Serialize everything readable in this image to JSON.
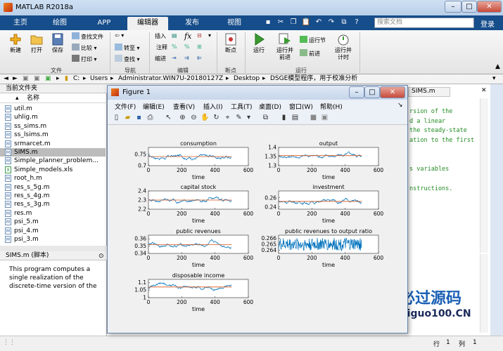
{
  "app": {
    "title": "MATLAB R2018a"
  },
  "tabs": [
    "主页",
    "绘图",
    "APP",
    "编辑器",
    "发布",
    "视图"
  ],
  "search": {
    "placeholder": "搜索文档"
  },
  "login": "登录",
  "ribbon": {
    "file": {
      "new": "新建",
      "open": "打开",
      "save": "保存",
      "find_files": "查找文件",
      "compare": "比较",
      "print": "打印",
      "label": "文件"
    },
    "nav": {
      "goto": "转至",
      "find": "查找",
      "label": "导航"
    },
    "edit": {
      "insert": "插入",
      "comment": "注释",
      "indent": "缩进",
      "label": "编辑",
      "fx": "fx"
    },
    "breakpoints": {
      "label": "断点",
      "btn": "断点"
    },
    "run": {
      "run": "运行",
      "run_advance": "运行并\n前进",
      "run_section": "运行节",
      "advance": "前进",
      "run_time": "运行并\n计时",
      "label": "运行"
    }
  },
  "address": {
    "path": [
      "C:",
      "Users",
      "Administrator.WIN7U-20180127Z",
      "Desktop",
      "DSGE模型程序，用于校准分析"
    ]
  },
  "current_folder": {
    "title": "当前文件夹",
    "column": "名称",
    "files": [
      "util.m",
      "uhlig.m",
      "ss_sims.m",
      "ss_lsims.m",
      "srmarcet.m",
      "SIMS.m",
      "Simple_planner_problem...",
      "Simple_models.xls",
      "root_h.m",
      "res_s_5g.m",
      "res_s_4g.m",
      "res_s_3g.m",
      "res.m",
      "psi_5.m",
      "psi_4.m",
      "psi_3.m"
    ],
    "selected": "SIMS.m"
  },
  "details": {
    "title": "SIMS.m  (脚本)",
    "text": "This program computes a single realization of the discrete-time version of the"
  },
  "editor": {
    "tab": "SIMS.m",
    "lines": [
      "rsion of the",
      "d a linear",
      " the steady-state",
      "ation to the first",
      "s variables",
      "nstructions."
    ]
  },
  "figure": {
    "title": "Figure 1",
    "menus": [
      "文件(F)",
      "编辑(E)",
      "查看(V)",
      "插入(I)",
      "工具(T)",
      "桌面(D)",
      "窗口(W)",
      "帮助(H)"
    ],
    "series_color": "#0072bd",
    "line_color": "#d95319"
  },
  "status": {
    "row_label": "行",
    "row": "1",
    "col_label": "列",
    "col": "1"
  },
  "watermark": {
    "text1": "必过源码",
    "text2": "Biguo100.CN"
  },
  "chart_data": [
    {
      "type": "line",
      "title": "consumption",
      "xlabel": "time",
      "xlim": [
        0,
        600
      ],
      "ylim": [
        0.7,
        0.78
      ],
      "yticks": [
        0.7,
        0.75
      ],
      "xticks": [
        0,
        200,
        400,
        600
      ],
      "mean": 0.74,
      "n": 500
    },
    {
      "type": "line",
      "title": "output",
      "xlabel": "time",
      "xlim": [
        0,
        600
      ],
      "ylim": [
        1.3,
        1.4
      ],
      "yticks": [
        1.3,
        1.35,
        1.4
      ],
      "xticks": [
        0,
        200,
        400,
        600
      ],
      "mean": 1.355,
      "n": 500
    },
    {
      "type": "line",
      "title": "capital stock",
      "xlabel": "time",
      "xlim": [
        0,
        600
      ],
      "ylim": [
        2.2,
        2.4
      ],
      "yticks": [
        2.2,
        2.3,
        2.4
      ],
      "xticks": [
        0,
        200,
        400,
        600
      ],
      "mean": 2.3,
      "n": 500
    },
    {
      "type": "line",
      "title": "investment",
      "xlabel": "time",
      "xlim": [
        0,
        600
      ],
      "ylim": [
        0.235,
        0.275
      ],
      "yticks": [
        0.24,
        0.26
      ],
      "xticks": [
        0,
        200,
        400,
        600
      ],
      "mean": 0.252,
      "n": 500
    },
    {
      "type": "line",
      "title": "public revenues",
      "xlabel": "time",
      "xlim": [
        0,
        600
      ],
      "ylim": [
        0.34,
        0.365
      ],
      "yticks": [
        0.34,
        0.35,
        0.36
      ],
      "xticks": [
        0,
        200,
        400,
        600
      ],
      "mean": 0.352,
      "n": 500
    },
    {
      "type": "line",
      "title": "public revenues to output ratio",
      "xlabel": "time",
      "xlim": [
        0,
        600
      ],
      "ylim": [
        0.2635,
        0.2665
      ],
      "yticks": [
        0.264,
        0.265,
        0.266
      ],
      "xticks": [
        0,
        200,
        400,
        600
      ],
      "mean": 0.265,
      "n": 500
    },
    {
      "type": "line",
      "title": "disposable income",
      "xlabel": "time",
      "xlim": [
        0,
        600
      ],
      "ylim": [
        1.0,
        1.12
      ],
      "yticks": [
        1,
        1.05,
        1.1
      ],
      "xticks": [
        0,
        200,
        400,
        600
      ],
      "mean": 1.07,
      "n": 500
    }
  ]
}
